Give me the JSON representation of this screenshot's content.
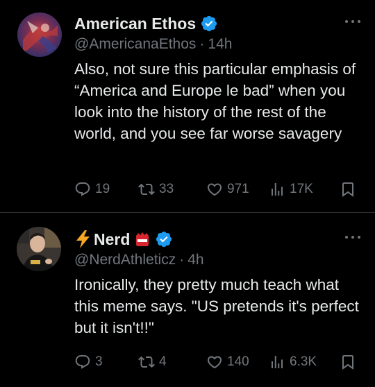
{
  "tweets": [
    {
      "display_name": "American Ethos",
      "handle": "@AmericanaEthos",
      "time": "14h",
      "text": "Also, not sure this particular emphasis of “America and Europe le bad” when you look into the history of the rest of the world, and you see far worse savagery",
      "replies": "19",
      "retweets": "33",
      "likes": "971",
      "views": "17K"
    },
    {
      "display_name_prefix": "⚡",
      "display_name": "Nerd",
      "handle": "@NerdAthleticz",
      "time": "4h",
      "text": "Ironically, they pretty much teach what this meme says. \"US pretends it's perfect but it isn't!!\"",
      "replies": "3",
      "retweets": "4",
      "likes": "140",
      "views": "6.3K"
    }
  ],
  "separator": "·",
  "colors": {
    "background": "#000000",
    "text_primary": "#e7e9ea",
    "text_secondary": "#71767b",
    "verified": "#1d9bf0",
    "divider": "#2f3336",
    "lightning": "#f5a623"
  },
  "icons": [
    "verified-badge-icon",
    "more-options-icon",
    "reply-icon",
    "retweet-icon",
    "like-icon",
    "views-icon",
    "bookmark-icon",
    "lightning-icon",
    "flag-badge-icon"
  ]
}
